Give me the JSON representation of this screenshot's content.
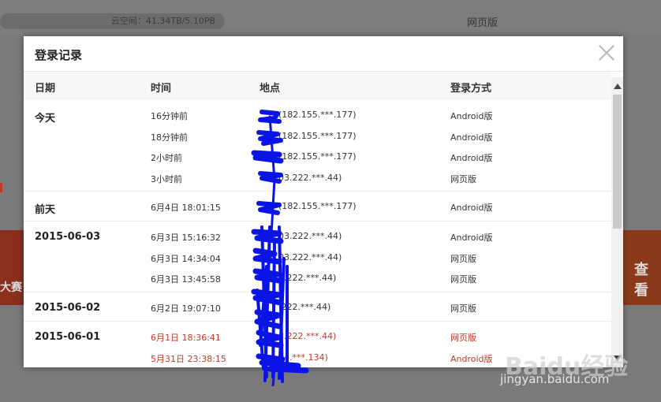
{
  "background": {
    "quota_text": "云空间：41.34TB/5.10PB",
    "web_version_text": "网页版",
    "banner_left_text": "大赛",
    "banner_right_text": "查看",
    "watermark_brand": "Baidu经验",
    "watermark_url": "jingyan.baidu.com"
  },
  "dialog": {
    "title": "登录记录",
    "columns": {
      "date": "日期",
      "time": "时间",
      "location": "地点",
      "method": "登录方式"
    },
    "groups": [
      {
        "date": "今天",
        "rows": [
          {
            "time": "16分钟前",
            "location": "(182.155.***.177)",
            "method": "Android版",
            "warn": false
          },
          {
            "time": "18分钟前",
            "location": "(182.155.***.177)",
            "method": "Android版",
            "warn": false
          },
          {
            "time": "2小时前",
            "location": "(182.155.***.177)",
            "method": "Android版",
            "warn": false
          },
          {
            "time": "3小时前",
            "location": "03.222.***.44)",
            "method": "网页版",
            "warn": false
          }
        ]
      },
      {
        "date": "前天",
        "rows": [
          {
            "time": "6月4日 18:01:15",
            "location": "(182.155.***.177)",
            "method": "Android版",
            "warn": false
          }
        ]
      },
      {
        "date": "2015-06-03",
        "rows": [
          {
            "time": "6月3日 15:16:32",
            "location": "03.222.***.44)",
            "method": "Android版",
            "warn": false
          },
          {
            "time": "6月3日 14:34:04",
            "location": "03.222.***.44)",
            "method": "网页版",
            "warn": false
          },
          {
            "time": "6月3日 13:45:58",
            "location": "3.222.***.44)",
            "method": "网页版",
            "warn": false
          }
        ]
      },
      {
        "date": "2015-06-02",
        "rows": [
          {
            "time": "6月2日 19:07:10",
            "location": ".222.***.44)",
            "method": "网页版",
            "warn": false
          }
        ]
      },
      {
        "date": "2015-06-01",
        "rows": [
          {
            "time": "6月1日 18:36:41",
            "location": "3.222.***.44)",
            "method": "网页版",
            "warn": true
          },
          {
            "time": "5月31日 23:38:15",
            "location": "54.***.134)",
            "method": "Android版",
            "warn": true
          }
        ]
      }
    ]
  },
  "colors": {
    "warn": "#c0392b",
    "redaction": "#0a14e6"
  }
}
